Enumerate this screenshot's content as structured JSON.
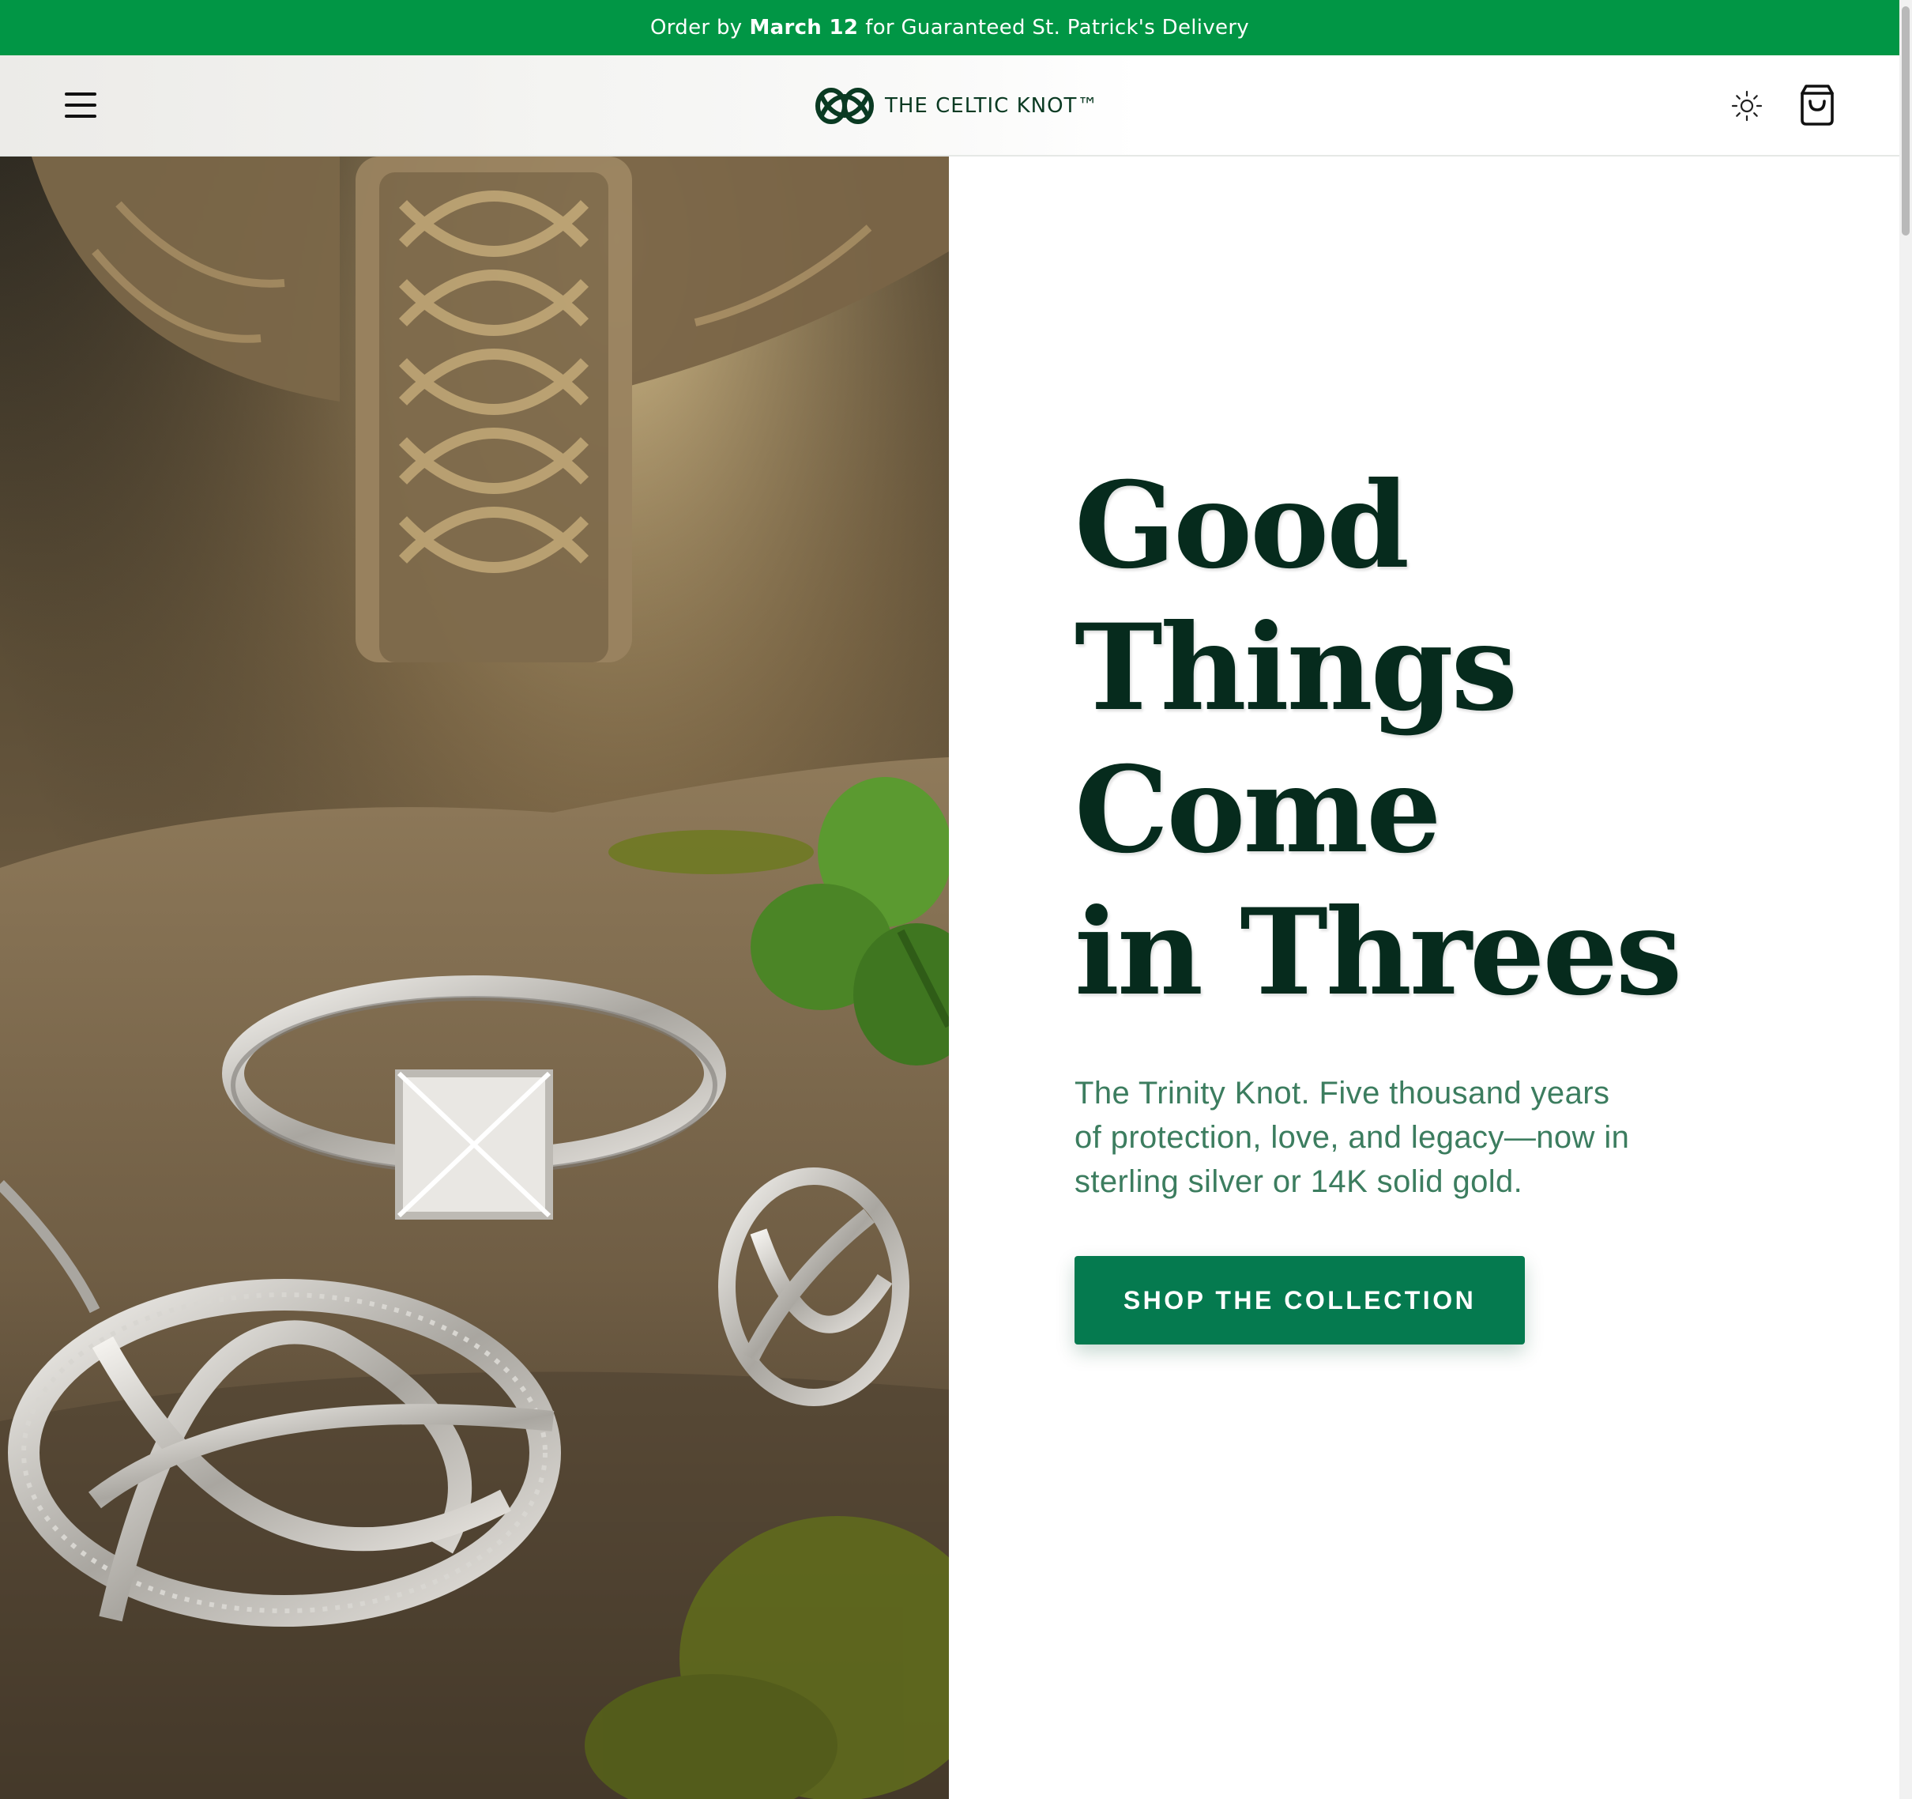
{
  "announcement": {
    "prefix": "Order by",
    "date": "March 12",
    "suffix": "for Guaranteed St. Patrick's Delivery"
  },
  "header": {
    "menu_icon": "hamburger-menu-icon",
    "brand_name": "THE CELTIC KNOT™",
    "logo_icon": "celtic-knot-logo-icon",
    "theme_icon": "sun-icon",
    "cart_icon": "shopping-bag-icon"
  },
  "hero": {
    "image_subject": "Celtic trinity knot ring, pendant and earrings on stone with shamrock and carved Celtic cross",
    "title": "Good\nThings\nCome\nin Threes",
    "description": "The Trinity Knot. Five thousand years of protection, love, and legacy—now in sterling silver or 14K solid gold.",
    "cta_label": "SHOP THE COLLECTION"
  },
  "colors": {
    "announcement_bg": "#019645",
    "brand_dark_green": "#062b1d",
    "description_green": "#3c7d5f",
    "cta_bg": "#057a4f"
  }
}
